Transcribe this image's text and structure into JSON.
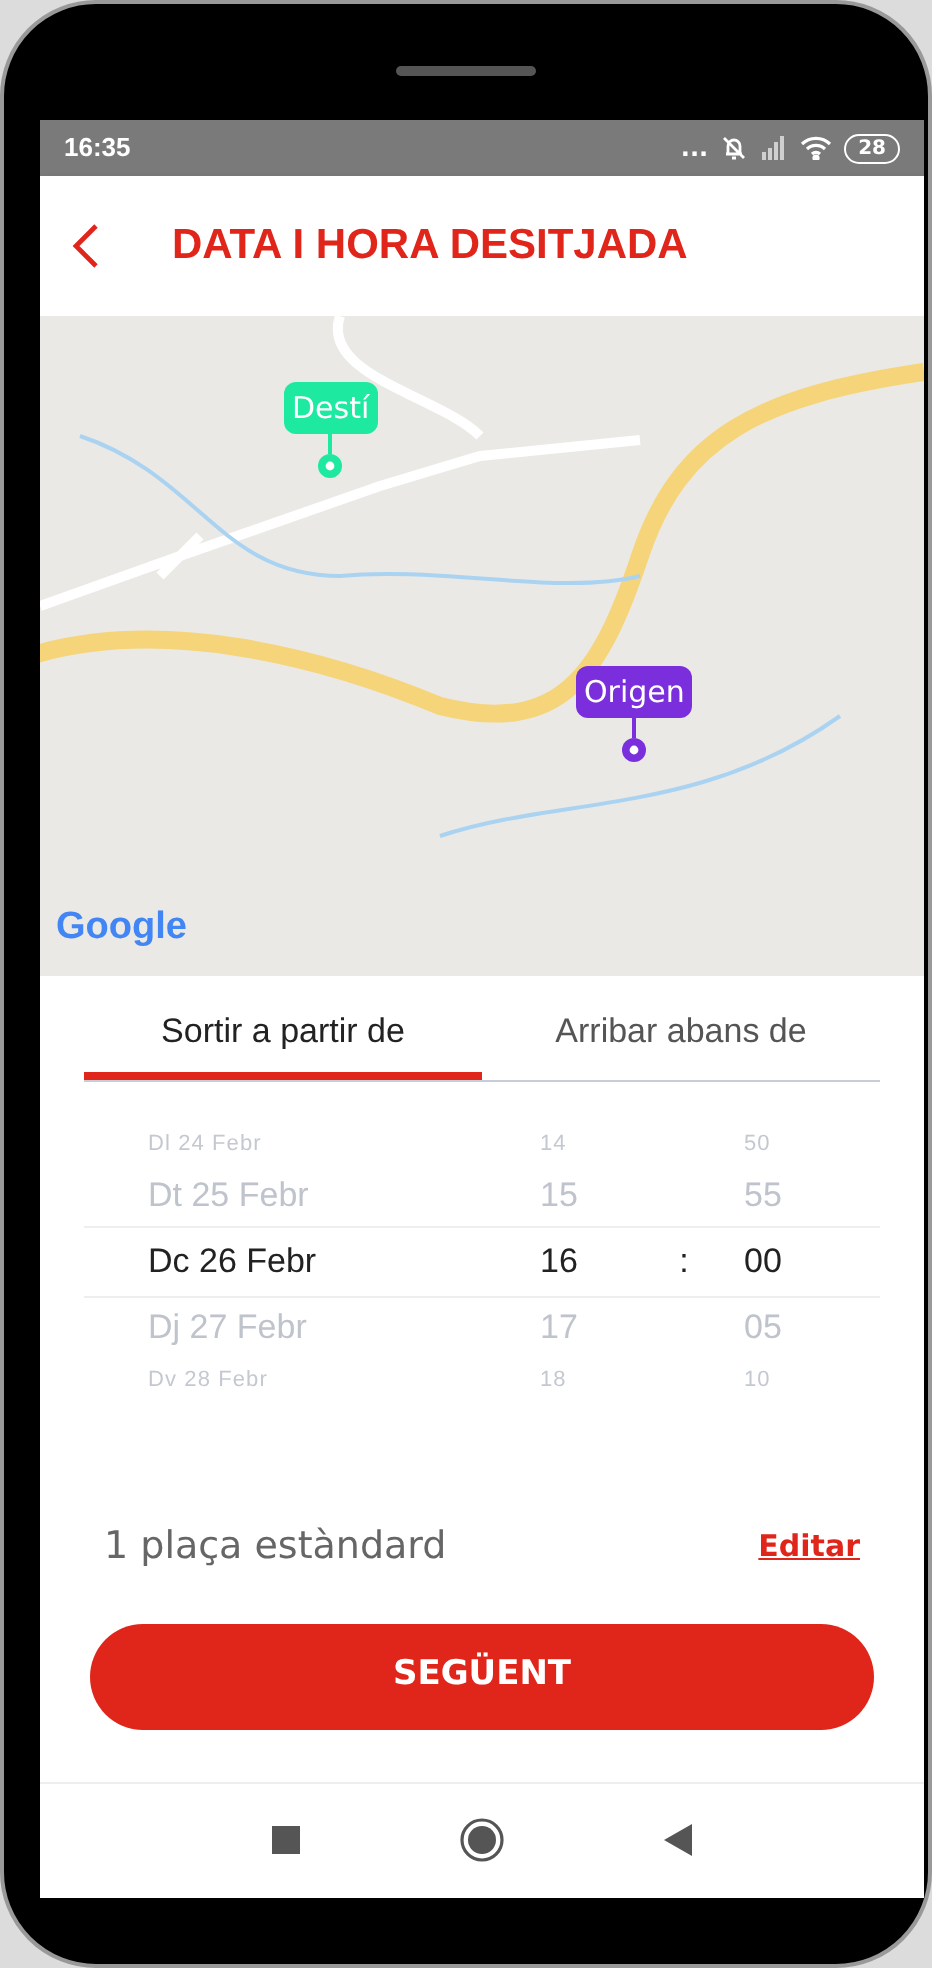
{
  "status_bar": {
    "time": "16:35",
    "more": "...",
    "battery": "28"
  },
  "header": {
    "title": "DATA I HORA DESITJADA"
  },
  "map": {
    "markers": [
      {
        "label": "Destí",
        "color": "#1de9a0"
      },
      {
        "label": "Origen",
        "color": "#7b2fdc"
      }
    ],
    "attribution": "Google"
  },
  "tabs": [
    {
      "label": "Sortir a partir de",
      "selected": true
    },
    {
      "label": "Arribar abans de",
      "selected": false
    }
  ],
  "picker": {
    "separator": ":",
    "rows": [
      {
        "day": "Dl 24 Febr",
        "hour": "14",
        "minute": "50",
        "selected": false
      },
      {
        "day": "Dt 25 Febr",
        "hour": "15",
        "minute": "55",
        "selected": false
      },
      {
        "day": "Dc 26 Febr",
        "hour": "16",
        "minute": "00",
        "selected": true
      },
      {
        "day": "Dj 27 Febr",
        "hour": "17",
        "minute": "05",
        "selected": false
      },
      {
        "day": "Dv 28 Febr",
        "hour": "18",
        "minute": "10",
        "selected": false
      }
    ]
  },
  "seats": {
    "text": "1 plaça estàndard",
    "edit_link": "Editar"
  },
  "next_button": "SEGÜENT"
}
